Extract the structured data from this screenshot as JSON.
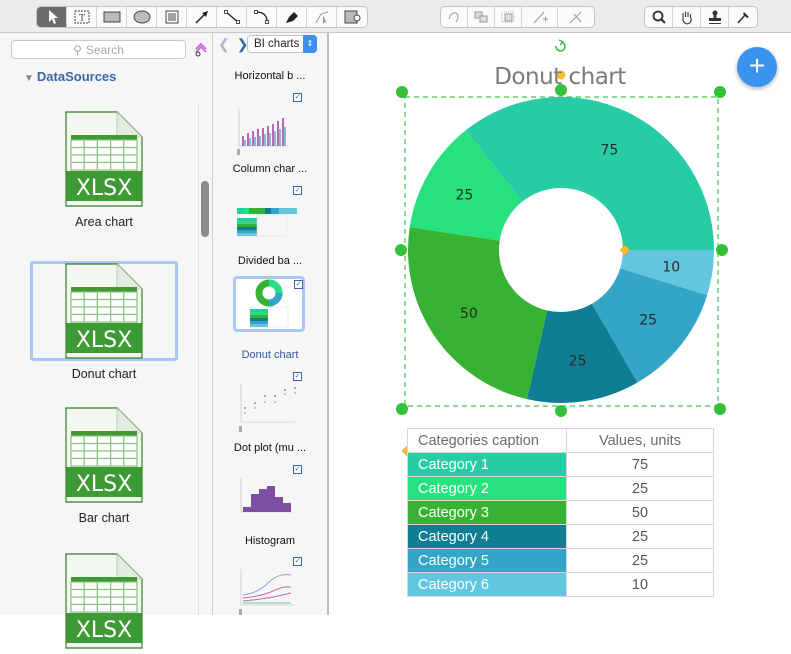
{
  "toolbar": {
    "drawing_tools": [
      "select-pointer",
      "text-box",
      "rectangle",
      "ellipse",
      "text-block",
      "arrow-connector",
      "line",
      "arc",
      "pen",
      "bezier",
      "insert-image"
    ],
    "edit_tools": [
      "rotate-arc",
      "group",
      "ungroup",
      "add-point",
      "cut-path"
    ],
    "view_tools": [
      "zoom",
      "pan-hand",
      "stamp",
      "eyedropper"
    ]
  },
  "left_panel": {
    "search_placeholder": "Search",
    "section_title": "DataSources",
    "items": [
      {
        "label": "Area chart",
        "icon_text": "XLSX",
        "selected": false
      },
      {
        "label": "Donut chart",
        "icon_text": "XLSX",
        "selected": true
      },
      {
        "label": "Bar chart",
        "icon_text": "XLSX",
        "selected": false
      },
      {
        "label": "",
        "icon_text": "XLSX",
        "selected": false
      }
    ]
  },
  "mid_panel": {
    "library": "BI charts",
    "items": [
      {
        "label": "Horizontal b ...",
        "selected": false
      },
      {
        "label": "Column char ...",
        "selected": false
      },
      {
        "label": "Divided ba ...",
        "selected": false
      },
      {
        "label": "Donut chart",
        "selected": true
      },
      {
        "label": "Dot plot (mu ...",
        "selected": false
      },
      {
        "label": "Histogram",
        "selected": false
      },
      {
        "label": "",
        "selected": false
      }
    ]
  },
  "canvas": {
    "add_button": "+"
  },
  "chart_data": {
    "type": "pie",
    "subtype": "donut",
    "title": "Donut chart",
    "direction": "counter-clockwise",
    "start": "3 o'clock",
    "categories": [
      "Category 1",
      "Category 2",
      "Category 3",
      "Category 4",
      "Category 5",
      "Category 6"
    ],
    "values": [
      75,
      25,
      50,
      25,
      25,
      10
    ],
    "colors": [
      "#27cba5",
      "#27e07e",
      "#38b232",
      "#107e92",
      "#33a5c7",
      "#62c6de"
    ],
    "table": {
      "headers": [
        "Categories caption",
        "Values, units"
      ]
    }
  }
}
